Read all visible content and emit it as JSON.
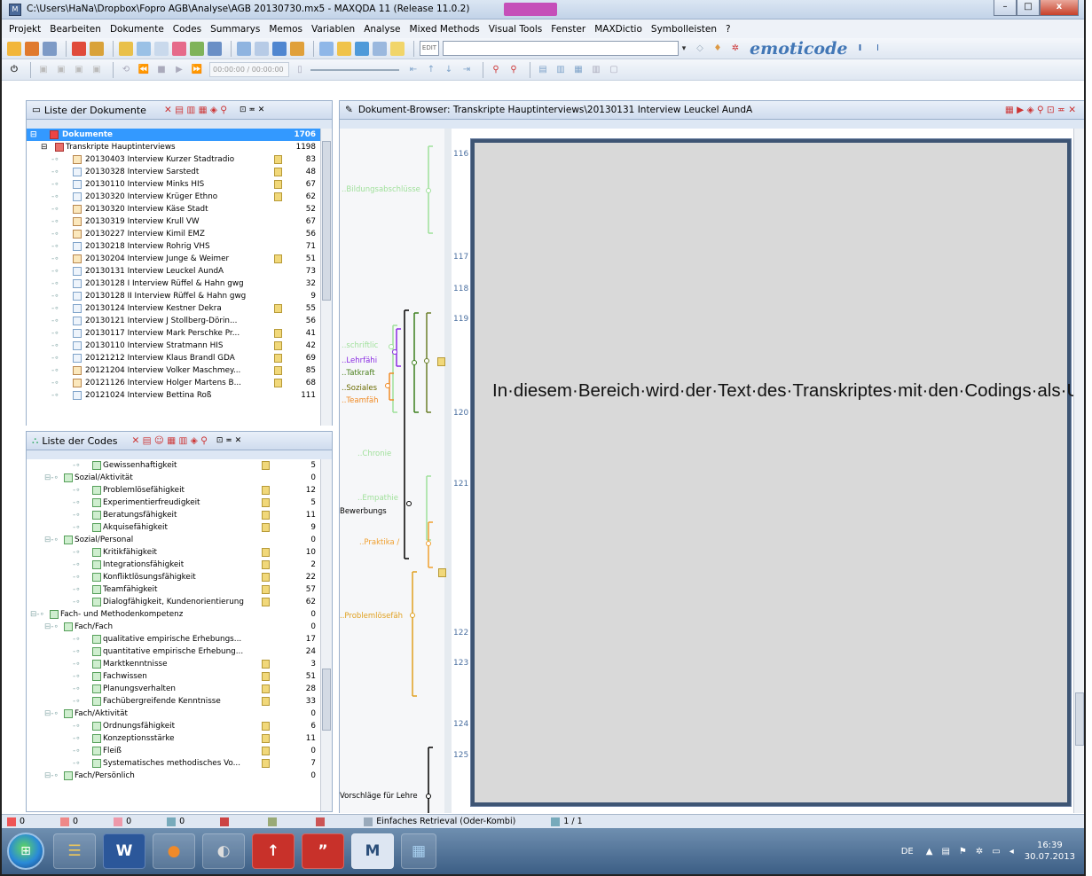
{
  "window": {
    "title": "C:\\Users\\HaNa\\Dropbox\\Fopro AGB\\Analyse\\AGB 20130730.mx5 - MAXQDA 11  (Release 11.0.2)",
    "min": "–",
    "max": "□",
    "close": "x"
  },
  "menu": [
    "Projekt",
    "Bearbeiten",
    "Dokumente",
    "Codes",
    "Summarys",
    "Memos",
    "Variablen",
    "Analyse",
    "Mixed Methods",
    "Visual Tools",
    "Fenster",
    "MAXDictio",
    "Symbolleisten",
    "?"
  ],
  "toolbar": {
    "edit_tag": "EDIT",
    "brand": "emoticode",
    "time_display": "00:00:00 / 00:00:00"
  },
  "docs_panel": {
    "title": "Liste der Dokumente",
    "root": {
      "label": "Dokumente",
      "count": "1706"
    },
    "group": {
      "label": "Transkripte Hauptinterviews",
      "count": "1198"
    },
    "items": [
      {
        "label": "20130403 Interview Kurzer Stadtradio",
        "count": "83",
        "memo": true,
        "type": "d"
      },
      {
        "label": "20130328 Interview Sarstedt",
        "count": "48",
        "memo": true,
        "type": "t"
      },
      {
        "label": "20130110 Interview Minks HIS",
        "count": "67",
        "memo": true,
        "type": "t"
      },
      {
        "label": "20130320 Interview Krüger Ethno",
        "count": "62",
        "memo": true,
        "type": "t"
      },
      {
        "label": "20130320 Interview Käse Stadt",
        "count": "52",
        "memo": false,
        "type": "d"
      },
      {
        "label": "20130319 Interview Krull VW",
        "count": "67",
        "memo": false,
        "type": "d"
      },
      {
        "label": "20130227 Interview Kimil EMZ",
        "count": "56",
        "memo": false,
        "type": "d"
      },
      {
        "label": "20130218 Interview Rohrig VHS",
        "count": "71",
        "memo": false,
        "type": "t"
      },
      {
        "label": "20130204 Interview Junge & Weimer",
        "count": "51",
        "memo": true,
        "type": "d"
      },
      {
        "label": "20130131 Interview Leuckel AundA",
        "count": "73",
        "memo": false,
        "type": "e"
      },
      {
        "label": "20130128 I Interview Rüffel & Hahn gwg",
        "count": "32",
        "memo": false,
        "type": "t"
      },
      {
        "label": "20130128 II Interview Rüffel & Hahn gwg",
        "count": "9",
        "memo": false,
        "type": "t"
      },
      {
        "label": "20130124 Interview Kestner Dekra",
        "count": "55",
        "memo": true,
        "type": "t"
      },
      {
        "label": "20130121 Interview J Stollberg-Dörin...",
        "count": "56",
        "memo": false,
        "type": "t"
      },
      {
        "label": "20130117 Interview Mark Perschke Pr...",
        "count": "41",
        "memo": true,
        "type": "t"
      },
      {
        "label": "20130110 Interview Stratmann HIS",
        "count": "42",
        "memo": true,
        "type": "t"
      },
      {
        "label": "20121212 Interview Klaus Brandl GDA",
        "count": "69",
        "memo": true,
        "type": "t"
      },
      {
        "label": "20121204 Interview Volker Maschmey...",
        "count": "85",
        "memo": true,
        "type": "d"
      },
      {
        "label": "20121126 Interview Holger Martens B...",
        "count": "68",
        "memo": true,
        "type": "d"
      },
      {
        "label": "20121024 Interview Bettina Roß",
        "count": "111",
        "memo": false,
        "type": "t"
      }
    ]
  },
  "codes_panel": {
    "title": "Liste der Codes",
    "items": [
      {
        "label": "Gewissenhaftigkeit",
        "count": "5",
        "memo": true,
        "level": 3
      },
      {
        "label": "Sozial/Aktivität",
        "count": "0",
        "memo": false,
        "level": 2
      },
      {
        "label": "Problemlösefähigkeit",
        "count": "12",
        "memo": true,
        "level": 3
      },
      {
        "label": "Experimentierfreudigkeit",
        "count": "5",
        "memo": true,
        "level": 3
      },
      {
        "label": "Beratungsfähigkeit",
        "count": "11",
        "memo": true,
        "level": 3
      },
      {
        "label": "Akquisefähigkeit",
        "count": "9",
        "memo": true,
        "level": 3
      },
      {
        "label": "Sozial/Personal",
        "count": "0",
        "memo": false,
        "level": 2
      },
      {
        "label": "Kritikfähigkeit",
        "count": "10",
        "memo": true,
        "level": 3
      },
      {
        "label": "Integrationsfähigkeit",
        "count": "2",
        "memo": true,
        "level": 3
      },
      {
        "label": "Konfliktlösungsfähigkeit",
        "count": "22",
        "memo": true,
        "level": 3
      },
      {
        "label": "Teamfähigkeit",
        "count": "57",
        "memo": true,
        "level": 3
      },
      {
        "label": "Dialogfähigkeit, Kundenorientierung",
        "count": "62",
        "memo": true,
        "level": 3
      },
      {
        "label": "Fach- und Methodenkompetenz",
        "count": "0",
        "memo": false,
        "level": 1
      },
      {
        "label": "Fach/Fach",
        "count": "0",
        "memo": false,
        "level": 2
      },
      {
        "label": "qualitative empirische Erhebungs...",
        "count": "17",
        "memo": false,
        "level": 3
      },
      {
        "label": "quantitative empirische Erhebung...",
        "count": "24",
        "memo": false,
        "level": 3
      },
      {
        "label": "Marktkenntnisse",
        "count": "3",
        "memo": true,
        "level": 3
      },
      {
        "label": "Fachwissen",
        "count": "51",
        "memo": true,
        "level": 3
      },
      {
        "label": "Planungsverhalten",
        "count": "28",
        "memo": true,
        "level": 3
      },
      {
        "label": "Fachübergreifende Kenntnisse",
        "count": "33",
        "memo": true,
        "level": 3
      },
      {
        "label": "Fach/Aktivität",
        "count": "0",
        "memo": false,
        "level": 2
      },
      {
        "label": "Ordnungsfähigkeit",
        "count": "6",
        "memo": true,
        "level": 3
      },
      {
        "label": "Konzeptionsstärke",
        "count": "11",
        "memo": true,
        "level": 3
      },
      {
        "label": "Fleiß",
        "count": "0",
        "memo": true,
        "level": 3
      },
      {
        "label": "Systematisches methodisches Vo...",
        "count": "7",
        "memo": true,
        "level": 3
      },
      {
        "label": "Fach/Persönlich",
        "count": "0",
        "memo": false,
        "level": 2
      }
    ]
  },
  "browser": {
    "title": "Dokument-Browser: Transkripte Hauptinterviews\\20130131 Interview Leuckel AundA",
    "line_numbers": [
      "116",
      "117",
      "118",
      "119",
      "120",
      "121",
      "122",
      "123",
      "124",
      "125"
    ],
    "code_labels": [
      {
        "text": "..Bildungsabschlüsse",
        "color": "#9fe09a"
      },
      {
        "text": "..schriftlic",
        "color": "#9fe09a"
      },
      {
        "text": "..Lehrfähi",
        "color": "#8a2be2"
      },
      {
        "text": "..Tatkraft",
        "color": "#4a7f1c"
      },
      {
        "text": "..Soziales",
        "color": "#6b6b00"
      },
      {
        "text": "..Teamfäh",
        "color": "#f08a24"
      },
      {
        "text": "..Chronie",
        "color": "#9fe09a"
      },
      {
        "text": "..Empathie",
        "color": "#9fe09a"
      },
      {
        "text": "Bewerbungs",
        "color": "#000000"
      },
      {
        "text": "..Praktika /",
        "color": "#f0a030"
      },
      {
        "text": "..Problemlösefäh",
        "color": "#e0a020"
      },
      {
        "text": "Vorschläge für Lehre",
        "color": "#000000"
      }
    ],
    "redacted_text": "In·diesem·Bereich·wird·der·Text·des·Transkriptes·mit·den·Codings·als·Unterstreichung·dargestellt.·Aus·Gründen·der·Anonymisierung·wurde·er·hier·geschwärzt.¶"
  },
  "statusbar": {
    "s1": "0",
    "s2": "0",
    "s3": "0",
    "s4": "0",
    "retrieval": "Einfaches Retrieval (Oder-Kombi)",
    "page": "1 / 1"
  },
  "taskbar": {
    "apps": [
      "☰",
      "W",
      "●",
      "◐",
      "↑",
      "”",
      "M",
      "▦"
    ],
    "lang": "DE",
    "time": "16:39",
    "date": "30.07.2013"
  }
}
